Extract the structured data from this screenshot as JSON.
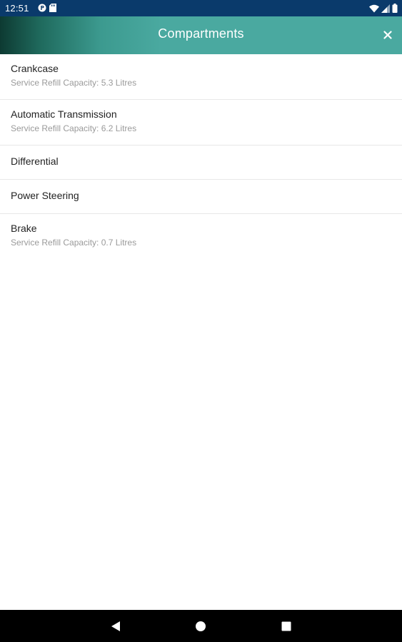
{
  "status_bar": {
    "time": "12:51",
    "left_icons": [
      "data-saver-icon",
      "sd-card-icon"
    ],
    "right_icons": [
      "wifi-icon",
      "cell-signal-icon",
      "battery-icon"
    ]
  },
  "header": {
    "title": "Compartments",
    "close_icon": "close-icon"
  },
  "compartments": [
    {
      "name": "Crankcase",
      "detail": "Service Refill Capacity: 5.3 Litres"
    },
    {
      "name": "Automatic Transmission",
      "detail": "Service Refill Capacity: 6.2 Litres"
    },
    {
      "name": "Differential",
      "detail": ""
    },
    {
      "name": "Power Steering",
      "detail": ""
    },
    {
      "name": "Brake",
      "detail": "Service Refill Capacity: 0.7 Litres"
    }
  ],
  "nav_bar": {
    "icons": [
      "back-icon",
      "home-icon",
      "recents-icon"
    ]
  },
  "colors": {
    "status_bar_bg": "#0a3a6b",
    "header_bg": "#4aa9a0",
    "header_gradient_dark": "#0d3a32",
    "title_text": "#222222",
    "subtitle_text": "#9a9a9a",
    "divider": "#e8e8e8",
    "nav_bar_bg": "#000000"
  }
}
